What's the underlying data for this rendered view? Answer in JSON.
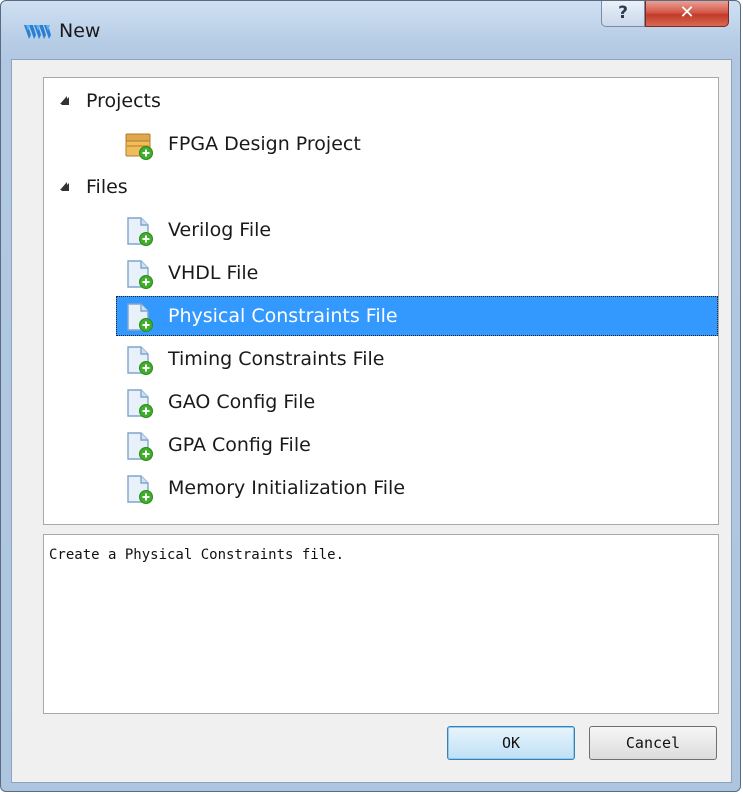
{
  "window": {
    "title": "New",
    "help_label": "?",
    "close_label": "✕"
  },
  "tree": {
    "groups": [
      {
        "label": "Projects",
        "items": [
          {
            "label": "FPGA Design Project",
            "icon": "project-box-icon"
          }
        ]
      },
      {
        "label": "Files",
        "items": [
          {
            "label": "Verilog File",
            "icon": "file-add-icon"
          },
          {
            "label": "VHDL File",
            "icon": "file-add-icon"
          },
          {
            "label": "Physical Constraints File",
            "icon": "file-add-icon",
            "selected": true
          },
          {
            "label": "Timing Constraints File",
            "icon": "file-add-icon"
          },
          {
            "label": "GAO Config File",
            "icon": "file-add-icon"
          },
          {
            "label": "GPA Config File",
            "icon": "file-add-icon"
          },
          {
            "label": "Memory Initialization File",
            "icon": "file-add-icon"
          }
        ]
      }
    ]
  },
  "description": "Create a Physical Constraints file.",
  "buttons": {
    "ok": "OK",
    "cancel": "Cancel"
  },
  "colors": {
    "selection": "#3399ff",
    "accent_green": "#3fae29"
  }
}
